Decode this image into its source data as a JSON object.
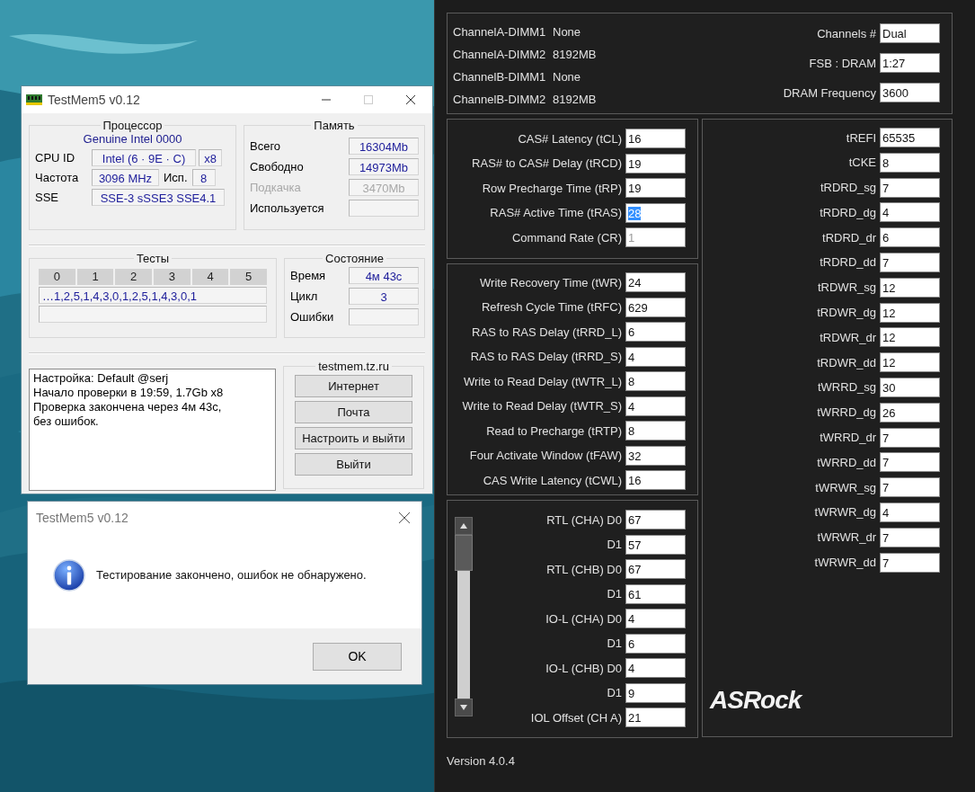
{
  "testmem": {
    "title": "TestMem5 v0.12",
    "processor": {
      "title": "Процессор",
      "cpu_name": "Genuine Intel  0000",
      "cpu_id_label": "CPU ID",
      "cpu_id": "Intel  (6 · 9E · C)",
      "threads": "x8",
      "freq_label": "Частота",
      "freq": "3096 MHz",
      "used_label": "Исп.",
      "used": "8",
      "sse_label": "SSE",
      "sse": "SSE-3 sSSE3 SSE4.1"
    },
    "memory": {
      "title": "Память",
      "rows": [
        {
          "label": "Всего",
          "value": "16304Mb",
          "disabled": false
        },
        {
          "label": "Свободно",
          "value": "14973Mb",
          "disabled": false
        },
        {
          "label": "Подкачка",
          "value": "3470Mb",
          "disabled": true
        },
        {
          "label": "Используется"
        }
      ]
    },
    "tests": {
      "title": "Тесты",
      "numbers": [
        "0",
        "1",
        "2",
        "3",
        "4",
        "5"
      ],
      "sequence": "…1,2,5,1,4,3,0,1,2,5,1,4,3,0,1"
    },
    "status": {
      "title": "Состояние",
      "rows": [
        {
          "label": "Время",
          "value": "4м 43с"
        },
        {
          "label": "Цикл",
          "value": "3"
        },
        {
          "label": "Ошибки"
        }
      ]
    },
    "log": [
      "Настройка: Default @serj",
      "Начало проверки в 19:59, 1.7Gb x8",
      "Проверка закончена через 4м 43с,",
      "без ошибок."
    ],
    "links": {
      "title": "testmem.tz.ru",
      "buttons": [
        "Интернет",
        "Почта",
        "Настроить и выйти",
        "Выйти"
      ]
    }
  },
  "message_box": {
    "title": "TestMem5 v0.12",
    "message": "Тестирование закончено, ошибок не обнаружено.",
    "button": "OK"
  },
  "timing": {
    "dimms": [
      {
        "slot": "ChannelA-DIMM1",
        "size": "None"
      },
      {
        "slot": "ChannelA-DIMM2",
        "size": "8192MB"
      },
      {
        "slot": "ChannelB-DIMM1",
        "size": "None"
      },
      {
        "slot": "ChannelB-DIMM2",
        "size": "8192MB"
      }
    ],
    "summary": [
      {
        "label": "Channels #",
        "value": "Dual"
      },
      {
        "label": "FSB : DRAM",
        "value": "1:27"
      },
      {
        "label": "DRAM Frequency",
        "value": "3600"
      }
    ],
    "primary": [
      {
        "label": "CAS# Latency (tCL)",
        "value": "16",
        "selected": false,
        "disabled": false
      },
      {
        "label": "RAS# to CAS# Delay (tRCD)",
        "value": "19",
        "selected": false,
        "disabled": false
      },
      {
        "label": "Row Precharge Time (tRP)",
        "value": "19",
        "selected": false,
        "disabled": false
      },
      {
        "label": "RAS# Active Time (tRAS)",
        "value": "28",
        "selected": true,
        "disabled": false
      },
      {
        "label": "Command Rate (CR)",
        "value": "1",
        "selected": false,
        "disabled": true
      }
    ],
    "secondary": [
      {
        "label": "Write Recovery Time (tWR)",
        "value": "24"
      },
      {
        "label": "Refresh Cycle Time (tRFC)",
        "value": "629"
      },
      {
        "label": "RAS to RAS Delay (tRRD_L)",
        "value": "6"
      },
      {
        "label": "RAS to RAS Delay (tRRD_S)",
        "value": "4"
      },
      {
        "label": "Write to Read Delay (tWTR_L)",
        "value": "8"
      },
      {
        "label": "Write to Read Delay (tWTR_S)",
        "value": "4"
      },
      {
        "label": "Read to Precharge (tRTP)",
        "value": "8"
      },
      {
        "label": "Four Activate Window (tFAW)",
        "value": "32"
      },
      {
        "label": "CAS Write Latency (tCWL)",
        "value": "16"
      }
    ],
    "training": [
      {
        "label": "RTL (CHA) D0",
        "value": "67"
      },
      {
        "label": "D1",
        "value": "57"
      },
      {
        "label": "RTL (CHB) D0",
        "value": "67"
      },
      {
        "label": "D1",
        "value": "61"
      },
      {
        "label": "IO-L (CHA) D0",
        "value": "4"
      },
      {
        "label": "D1",
        "value": "6"
      },
      {
        "label": "IO-L (CHB) D0",
        "value": "4"
      },
      {
        "label": "D1",
        "value": "9"
      },
      {
        "label": "IOL Offset (CH A)",
        "value": "21"
      }
    ],
    "tertiary": [
      {
        "label": "tREFI",
        "value": "65535"
      },
      {
        "label": "tCKE",
        "value": "8"
      },
      {
        "label": "tRDRD_sg",
        "value": "7"
      },
      {
        "label": "tRDRD_dg",
        "value": "4"
      },
      {
        "label": "tRDRD_dr",
        "value": "6"
      },
      {
        "label": "tRDRD_dd",
        "value": "7"
      },
      {
        "label": "tRDWR_sg",
        "value": "12"
      },
      {
        "label": "tRDWR_dg",
        "value": "12"
      },
      {
        "label": "tRDWR_dr",
        "value": "12"
      },
      {
        "label": "tRDWR_dd",
        "value": "12"
      },
      {
        "label": "tWRRD_sg",
        "value": "30"
      },
      {
        "label": "tWRRD_dg",
        "value": "26"
      },
      {
        "label": "tWRRD_dr",
        "value": "7"
      },
      {
        "label": "tWRRD_dd",
        "value": "7"
      },
      {
        "label": "tWRWR_sg",
        "value": "7"
      },
      {
        "label": "tWRWR_dg",
        "value": "4"
      },
      {
        "label": "tWRWR_dr",
        "value": "7"
      },
      {
        "label": "tWRWR_dd",
        "value": "7"
      }
    ],
    "logo": "ASRock",
    "version": "Version 4.0.4"
  }
}
